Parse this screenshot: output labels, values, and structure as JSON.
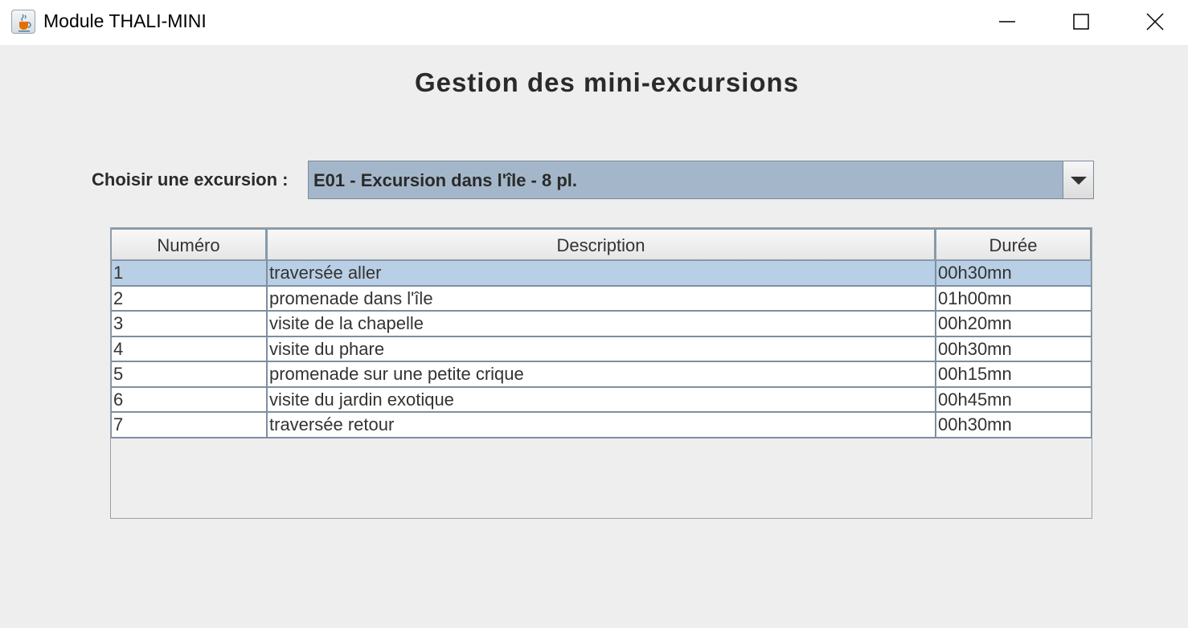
{
  "window": {
    "title": "Module THALI-MINI",
    "icon": "java-cup-icon"
  },
  "heading": "Gestion des mini-excursions",
  "excursion_select": {
    "label": "Choisir une excursion :",
    "selected_value": "E01 - Excursion dans l'île - 8 pl."
  },
  "table": {
    "columns": [
      "Numéro",
      "Description",
      "Durée"
    ],
    "rows": [
      {
        "numero": "1",
        "description": "traversée aller",
        "duree": "00h30mn"
      },
      {
        "numero": "2",
        "description": "promenade dans l'île",
        "duree": "01h00mn"
      },
      {
        "numero": "3",
        "description": "visite de la chapelle",
        "duree": "00h20mn"
      },
      {
        "numero": "4",
        "description": "visite du phare",
        "duree": "00h30mn"
      },
      {
        "numero": "5",
        "description": "promenade sur une petite crique",
        "duree": "00h15mn"
      },
      {
        "numero": "6",
        "description": "visite du jardin exotique",
        "duree": "00h45mn"
      },
      {
        "numero": "7",
        "description": "traversée retour",
        "duree": "00h30mn"
      }
    ],
    "selected_row": 1
  },
  "colors": {
    "selection": "#b8cfe5",
    "combo_background": "#a4b7ca",
    "window_background": "#eeeeee"
  }
}
